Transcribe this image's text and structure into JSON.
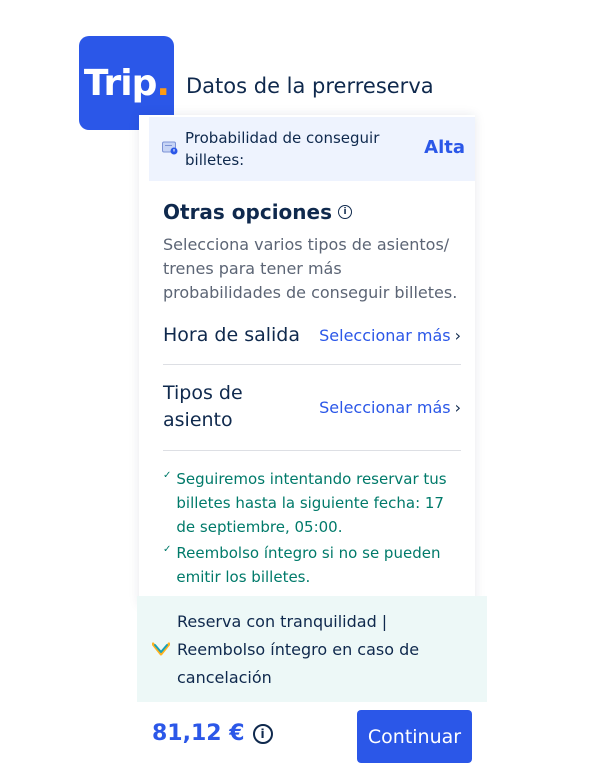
{
  "logo": {
    "text": "Trip",
    "dot": "."
  },
  "page_title": "Datos de la prerreserva",
  "probability": {
    "label": "Probabilidad de conseguir billetes:",
    "value": "Alta",
    "icon": "ticket-icon"
  },
  "options": {
    "title": "Otras opciones",
    "title_icon": "info-icon",
    "description": "Selecciona varios tipos de asientos/ trenes para tener más probabilidades de conseguir billetes."
  },
  "rows": [
    {
      "label": "Hora de salida",
      "link": "Seleccionar más",
      "chevron": "›"
    },
    {
      "label": "Tipos de asiento",
      "link": "Seleccionar más",
      "chevron": "›"
    }
  ],
  "guarantees": [
    {
      "check": "✓",
      "text": "Seguiremos intentando reservar tus billetes hasta la siguiente fecha: 17 de septiembre, 05:00."
    },
    {
      "check": "✓",
      "text": "Reembolso íntegro si no se pueden emitir los billetes."
    }
  ],
  "promo": {
    "text": "Reserva con tranquilidad | Reembolso íntegro en caso de cancelación",
    "icon": "shield-check-icon"
  },
  "footer": {
    "price": "81,12 €",
    "price_info_icon": "info-icon",
    "continue_label": "Continuar"
  },
  "colors": {
    "brand_blue": "#2b57e8",
    "logo_dot": "#ff9a14",
    "guarantee_green": "#007a6a",
    "text_dark": "#0f294d"
  }
}
